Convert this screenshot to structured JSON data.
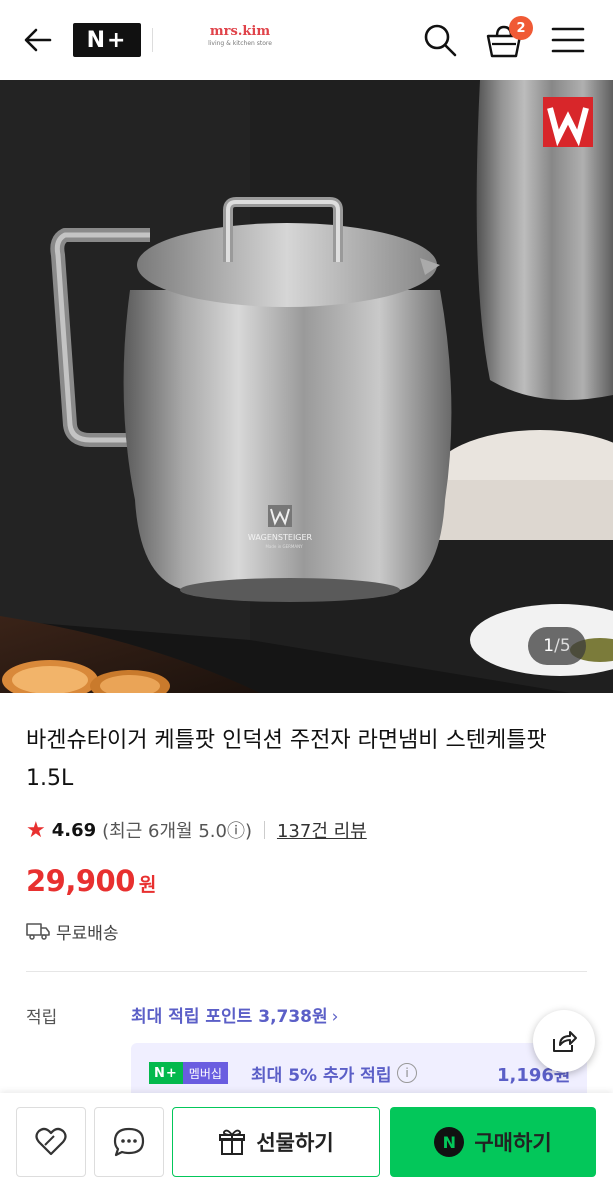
{
  "header": {
    "logo_text": "N+",
    "store_name": "mrs.kim",
    "store_tagline": "living & kitchen store",
    "cart_count": "2",
    "icons": [
      "back-arrow-icon",
      "search-icon",
      "cart-icon",
      "menu-icon"
    ]
  },
  "gallery": {
    "current": "1",
    "separator": " / ",
    "total": "5",
    "image_text": {
      "brand": "WAGENSTEIGER",
      "brand_sub": "Made in GERMANY"
    }
  },
  "product": {
    "title": "바겐슈타이거 케틀팟 인덕션 주전자 라면냄비 스텐케틀팟 1.5L",
    "rating": "4.69",
    "rating_note": "(최근 6개월 5.0ⓘ)",
    "review_link": "137건 리뷰",
    "price": "29,900",
    "currency": "원",
    "shipping": "무료배송"
  },
  "points": {
    "label": "적립",
    "max_points": "최대 적립 포인트 3,738원",
    "membership_badge_n": "N+",
    "membership_badge_label": "멤버십",
    "membership_text": "최대 5% 추가 적립",
    "membership_amount": "1,196원"
  },
  "actions": {
    "gift_label": "선물하기",
    "buy_label": "구매하기",
    "buy_icon_letter": "N"
  },
  "colors": {
    "price_red": "#e8302f",
    "naver_green": "#03c75a",
    "points_purple": "#5b5fc7",
    "badge_orange": "#f05a35"
  }
}
